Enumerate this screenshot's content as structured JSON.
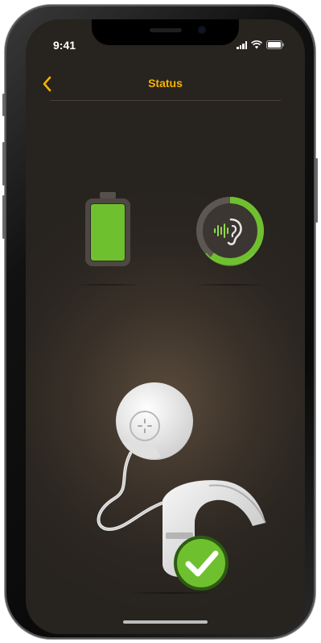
{
  "status_bar": {
    "time": "9:41"
  },
  "nav": {
    "title": "Status"
  },
  "colors": {
    "accent": "#f4b400",
    "battery_fill": "#6fc02e",
    "ring_progress": "#6fc02e",
    "check_badge": "#6fc02e"
  },
  "icons": {
    "back": "chevron-left-icon",
    "battery": "battery-icon",
    "hearing": "ear-sound-icon",
    "success": "checkmark-icon"
  },
  "status": {
    "battery_level": 1.0,
    "hearing_ring_level": 0.6
  }
}
